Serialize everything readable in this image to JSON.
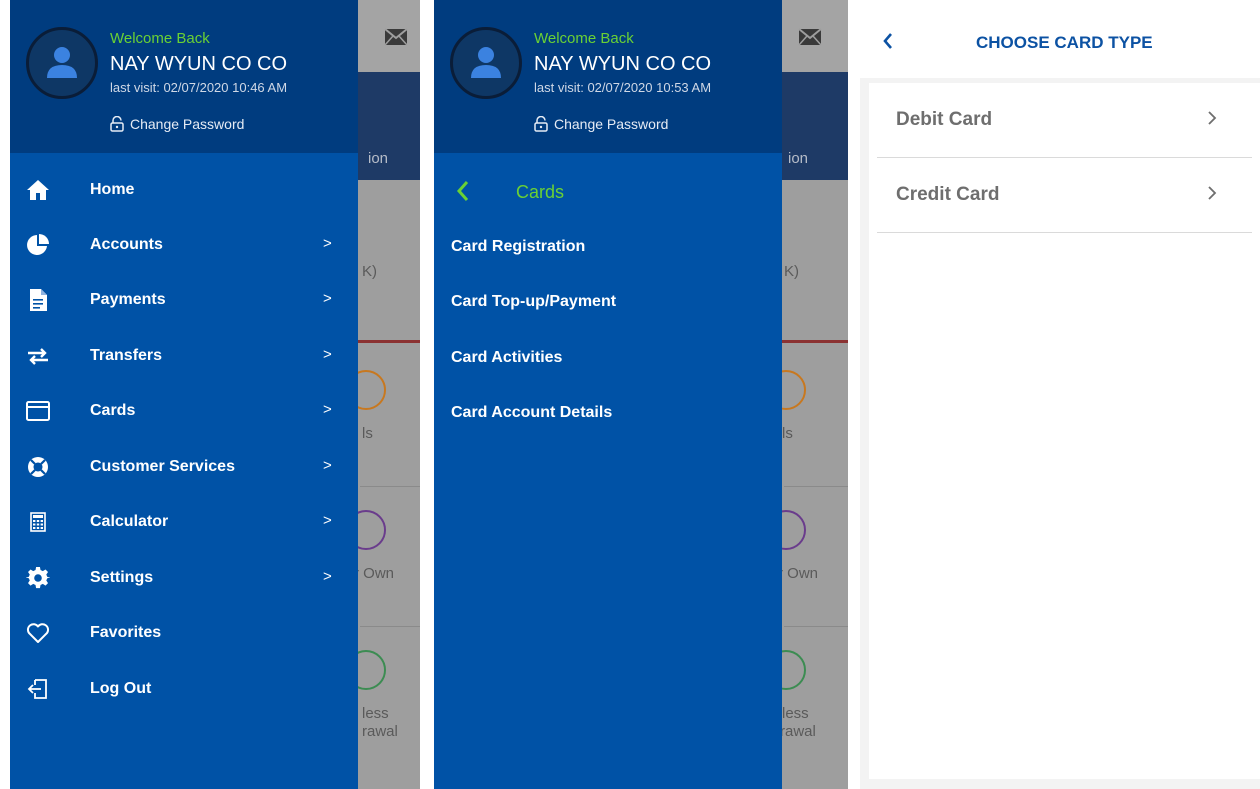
{
  "profile": {
    "welcome": "Welcome Back",
    "name": "NAY WYUN  CO CO",
    "last_visit_1": "last visit: 02/07/2020 10:46 AM",
    "last_visit_2": "last visit: 02/07/2020 10:53 AM",
    "change_password": "Change Password"
  },
  "background": {
    "band_label": "ion",
    "item_1": "K)",
    "item_2": "ls",
    "item_3": "r Own",
    "item_4_line1": "less",
    "item_4_line2": "rawal"
  },
  "menu": {
    "items": [
      {
        "label": "Home",
        "icon": "home-icon",
        "chevron": ""
      },
      {
        "label": "Accounts",
        "icon": "pie-chart-icon",
        "chevron": ">"
      },
      {
        "label": "Payments",
        "icon": "document-icon",
        "chevron": ">"
      },
      {
        "label": "Transfers",
        "icon": "transfer-arrows-icon",
        "chevron": ">"
      },
      {
        "label": "Cards",
        "icon": "card-icon",
        "chevron": ">"
      },
      {
        "label": "Customer Services",
        "icon": "lifebuoy-icon",
        "chevron": ">"
      },
      {
        "label": "Calculator",
        "icon": "calculator-icon",
        "chevron": ">"
      },
      {
        "label": "Settings",
        "icon": "gear-icon",
        "chevron": ">"
      },
      {
        "label": "Favorites",
        "icon": "heart-icon",
        "chevron": ""
      },
      {
        "label": "Log Out",
        "icon": "logout-icon",
        "chevron": ""
      }
    ]
  },
  "cards_submenu": {
    "title": "Cards",
    "items": [
      "Card Registration",
      "Card Top-up/Payment",
      "Card Activities",
      "Card Account Details"
    ]
  },
  "choose_card": {
    "title": "CHOOSE CARD TYPE",
    "options": [
      "Debit Card",
      "Credit Card"
    ]
  },
  "colors": {
    "drawer": "#0052a6",
    "profile": "#003c7f",
    "accent_green": "#6ad134",
    "title_blue": "#0c52a3"
  }
}
